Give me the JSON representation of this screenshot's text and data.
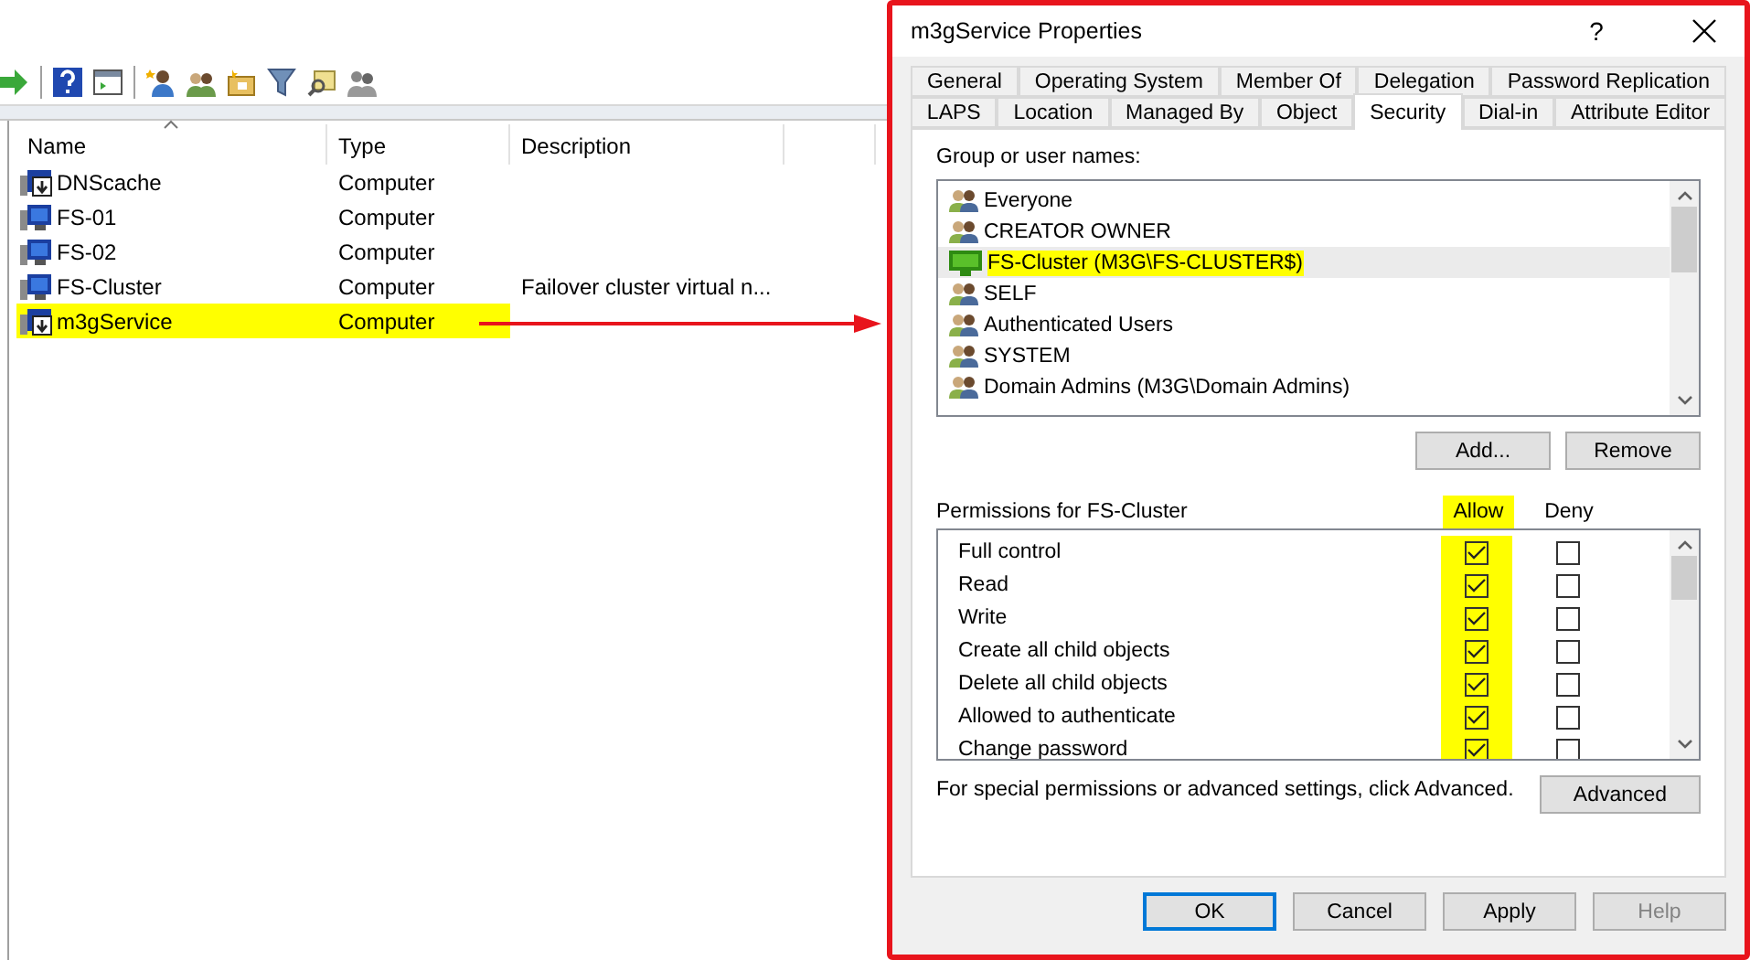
{
  "objects": {
    "columns": [
      {
        "label": "Name",
        "sorted": true
      },
      {
        "label": "Type",
        "sorted": false
      },
      {
        "label": "Description",
        "sorted": false
      }
    ],
    "rows": [
      {
        "kind": "service",
        "name": "DNScache",
        "type": "Computer",
        "description": "",
        "highlighted": false
      },
      {
        "kind": "computer",
        "name": "FS-01",
        "type": "Computer",
        "description": "",
        "highlighted": false
      },
      {
        "kind": "computer",
        "name": "FS-02",
        "type": "Computer",
        "description": "",
        "highlighted": false
      },
      {
        "kind": "computer",
        "name": "FS-Cluster",
        "type": "Computer",
        "description": "Failover cluster virtual n...",
        "highlighted": false
      },
      {
        "kind": "service",
        "name": "m3gService",
        "type": "Computer",
        "description": "",
        "highlighted": true
      }
    ]
  },
  "dialog": {
    "title": "m3gService Properties",
    "help": "?",
    "tab_rows": [
      [
        {
          "label": "General",
          "selected": false
        },
        {
          "label": "Operating System",
          "selected": false
        },
        {
          "label": "Member Of",
          "selected": false
        },
        {
          "label": "Delegation",
          "selected": false
        },
        {
          "label": "Password Replication",
          "selected": false
        }
      ],
      [
        {
          "label": "LAPS",
          "selected": false
        },
        {
          "label": "Location",
          "selected": false
        },
        {
          "label": "Managed By",
          "selected": false
        },
        {
          "label": "Object",
          "selected": false
        },
        {
          "label": "Security",
          "selected": true
        },
        {
          "label": "Dial-in",
          "selected": false
        },
        {
          "label": "Attribute Editor",
          "selected": false
        }
      ]
    ],
    "groups_label": "Group or user names:",
    "groups": [
      {
        "kind": "group",
        "name": "Everyone",
        "selected": false,
        "highlighted": false
      },
      {
        "kind": "group",
        "name": "CREATOR OWNER",
        "selected": false,
        "highlighted": false
      },
      {
        "kind": "computer",
        "name": "FS-Cluster (M3G\\FS-CLUSTER$)",
        "selected": true,
        "highlighted": true
      },
      {
        "kind": "group",
        "name": "SELF",
        "selected": false,
        "highlighted": false
      },
      {
        "kind": "group",
        "name": "Authenticated Users",
        "selected": false,
        "highlighted": false
      },
      {
        "kind": "group",
        "name": "SYSTEM",
        "selected": false,
        "highlighted": false
      },
      {
        "kind": "group",
        "name": "Domain Admins (M3G\\Domain Admins)",
        "selected": false,
        "highlighted": false
      }
    ],
    "group_buttons": [
      "Add...",
      "Remove"
    ],
    "permissions_label": "Permissions for FS-Cluster",
    "allow_label": "Allow",
    "deny_label": "Deny",
    "allow_highlighted": true,
    "permissions": [
      {
        "name": "Full control",
        "allow": true,
        "deny": false
      },
      {
        "name": "Read",
        "allow": true,
        "deny": false
      },
      {
        "name": "Write",
        "allow": true,
        "deny": false
      },
      {
        "name": "Create all child objects",
        "allow": true,
        "deny": false
      },
      {
        "name": "Delete all child objects",
        "allow": true,
        "deny": false
      },
      {
        "name": "Allowed to authenticate",
        "allow": true,
        "deny": false
      },
      {
        "name": "Change password",
        "allow": true,
        "deny": false
      }
    ],
    "note": "For special permissions or advanced settings, click Advanced.",
    "advanced_button": "Advanced",
    "buttons": [
      {
        "label": "OK",
        "default": true,
        "disabled": false
      },
      {
        "label": "Cancel",
        "default": false,
        "disabled": false
      },
      {
        "label": "Apply",
        "default": false,
        "disabled": false
      },
      {
        "label": "Help",
        "default": false,
        "disabled": true
      }
    ]
  }
}
